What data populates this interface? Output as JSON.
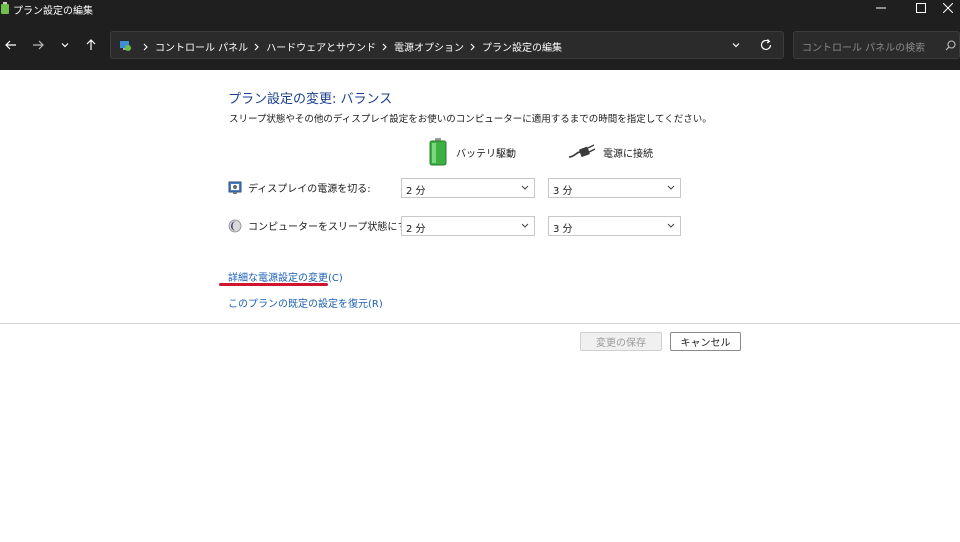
{
  "window": {
    "title": "プラン設定の編集"
  },
  "address_bar": {
    "crumbs": [
      "コントロール パネル",
      "ハードウェアとサウンド",
      "電源オプション",
      "プラン設定の編集"
    ]
  },
  "search": {
    "placeholder": "コントロール パネルの検索"
  },
  "main": {
    "heading": "プラン設定の変更: バランス",
    "description": "スリープ状態やその他のディスプレイ設定をお使いのコンピューターに適用するまでの時間を指定してください。",
    "columns": {
      "battery": "バッテリ駆動",
      "plugged": "電源に接続"
    },
    "rows": [
      {
        "label": "ディスプレイの電源を切る:",
        "battery_value": "2 分",
        "plugged_value": "3 分"
      },
      {
        "label": "コンピューターをスリープ状態にする:",
        "battery_value": "2 分",
        "plugged_value": "3 分"
      }
    ],
    "links": {
      "advanced": "詳細な電源設定の変更(C)",
      "restore": "このプランの既定の設定を復元(R)"
    },
    "buttons": {
      "save": "変更の保存",
      "cancel": "キャンセル"
    }
  },
  "colors": {
    "titlebar": "#1f1f1f",
    "heading": "#1b3f8f",
    "link": "#1b5fb5",
    "annotation": "#d0162f",
    "battery_green": "#3cb043"
  }
}
